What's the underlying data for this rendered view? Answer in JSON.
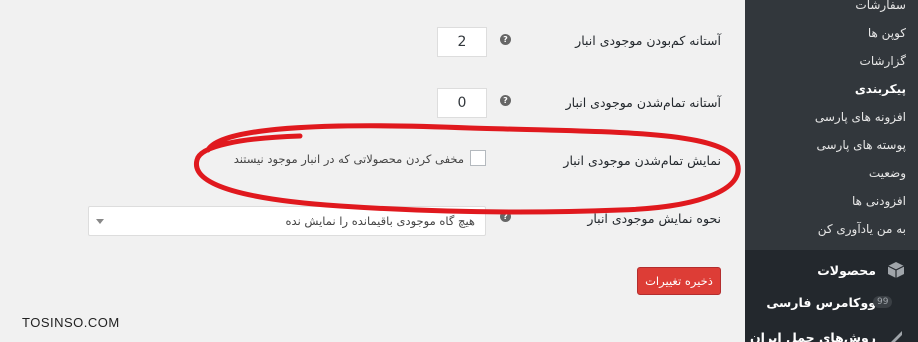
{
  "sidebar": {
    "submenu": [
      {
        "label": "سفارشات"
      },
      {
        "label": "کوپن ها"
      },
      {
        "label": "گزارشات"
      },
      {
        "label": "پیکربندی"
      },
      {
        "label": "افزونه های پارسی"
      },
      {
        "label": "پوسته های پارسی"
      },
      {
        "label": "وضعیت"
      },
      {
        "label": "افزودنی ها"
      },
      {
        "label": "به من یادآوری کن"
      }
    ],
    "menu": [
      {
        "label": "محصولات",
        "icon": "box-icon"
      },
      {
        "label": "ووکامرس فارسی",
        "badge": "99"
      },
      {
        "label": "روش‌های حمل ایران",
        "icon": "shipping-icon"
      }
    ]
  },
  "settings": {
    "low_stock": {
      "label": "آستانه کم‌بودن موجودی انبار",
      "value": "2"
    },
    "out_of_stock": {
      "label": "آستانه تمام‌شدن موجودی انبار",
      "value": "0"
    },
    "out_of_stock_visibility": {
      "label": "نمایش تمام‌شدن موجودی انبار",
      "checkbox_label": "مخفی کردن محصولاتی که در انبار موجود نیستند"
    },
    "stock_format": {
      "label": "نحوه نمایش موجودی انبار",
      "selected": "هیچ گاه موجودی باقیمانده را نمایش نده"
    }
  },
  "save_label": "ذخیره تغییرات",
  "watermark": "TOSINSO.COM",
  "colors": {
    "annotation": "#e0191e",
    "save_button": "#dd3d36",
    "sidebar": "#23282d"
  }
}
